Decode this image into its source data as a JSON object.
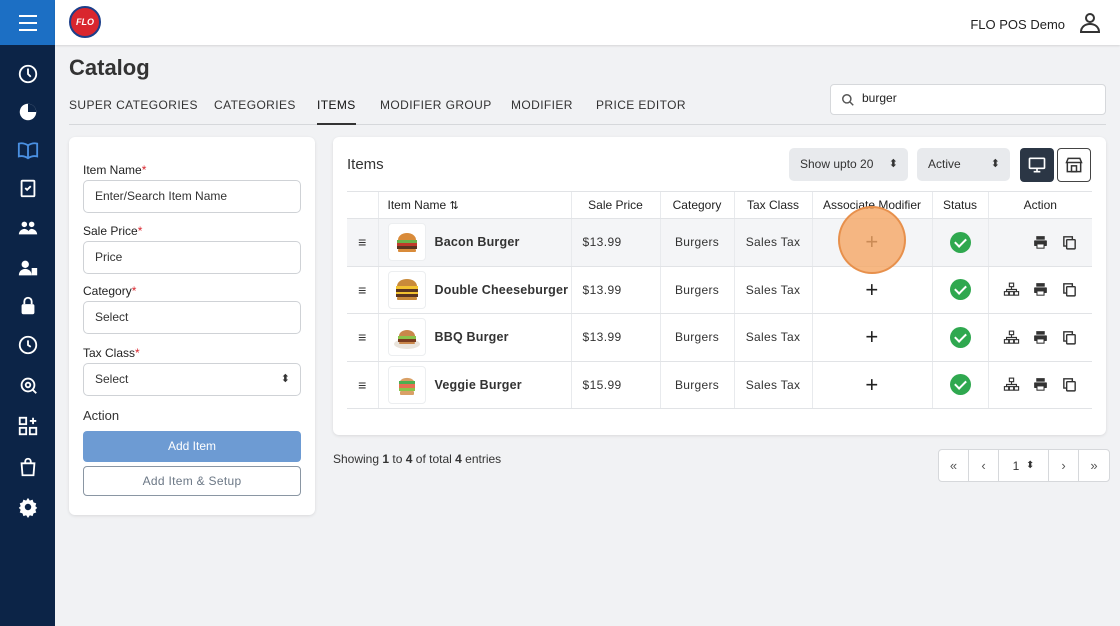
{
  "app": {
    "store_name": "FLO POS Demo",
    "logo_text": "FLO"
  },
  "page": {
    "title": "Catalog"
  },
  "tabs": [
    "SUPER CATEGORIES",
    "CATEGORIES",
    "ITEMS",
    "MODIFIER GROUP",
    "MODIFIER",
    "PRICE EDITOR"
  ],
  "active_tab": "ITEMS",
  "search": {
    "value": "burger"
  },
  "form": {
    "item_name_label": "Item Name",
    "item_name_placeholder": "Enter/Search Item Name",
    "sale_price_label": "Sale Price",
    "sale_price_placeholder": "Price",
    "category_label": "Category",
    "category_value": "Select",
    "tax_class_label": "Tax Class",
    "tax_class_value": "Select",
    "required_mark": "*",
    "action_label": "Action",
    "add_item": "Add Item",
    "add_item_setup": "Add Item & Setup"
  },
  "items_panel": {
    "title": "Items",
    "show_select": "Show upto 20",
    "status_select": "Active",
    "columns": [
      "Item Name",
      "Sale Price",
      "Category",
      "Tax Class",
      "Associate Modifier",
      "Status",
      "Action"
    ],
    "sort_icon": "⇅",
    "rows": [
      {
        "name": "Bacon Burger",
        "price": "$13.99",
        "category": "Burgers",
        "tax_class": "Sales Tax",
        "status": "active"
      },
      {
        "name": "Double Cheeseburger",
        "price": "$13.99",
        "category": "Burgers",
        "tax_class": "Sales Tax",
        "status": "active"
      },
      {
        "name": "BBQ Burger",
        "price": "$13.99",
        "category": "Burgers",
        "tax_class": "Sales Tax",
        "status": "active"
      },
      {
        "name": "Veggie Burger",
        "price": "$15.99",
        "category": "Burgers",
        "tax_class": "Sales Tax",
        "status": "active"
      }
    ]
  },
  "footer": {
    "prefix": "Showing ",
    "from": "1",
    "mid": " to ",
    "to": "4",
    "mid2": " of total ",
    "total": "4",
    "suffix": " entries"
  },
  "pagination": {
    "first": "«",
    "prev": "‹",
    "page": "1",
    "next": "›",
    "last": "»"
  },
  "colors": {
    "sidebar": "#0c2447",
    "hamburger": "#1c6fc4",
    "primary_button": "#6d9bd3",
    "status_green": "#2fa84f",
    "highlight": "#f5a664",
    "required": "#d9262e"
  }
}
